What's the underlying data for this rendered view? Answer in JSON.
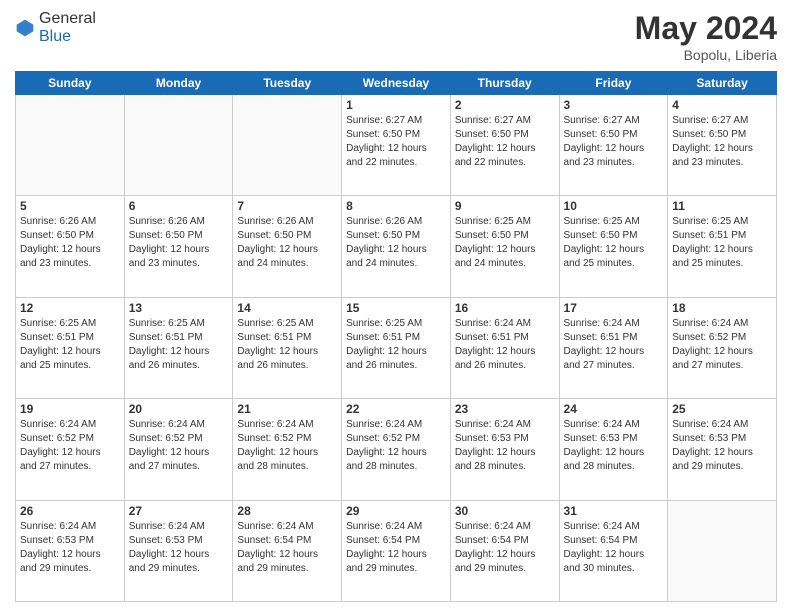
{
  "logo": {
    "general": "General",
    "blue": "Blue"
  },
  "header": {
    "month_year": "May 2024",
    "location": "Bopolu, Liberia"
  },
  "days_of_week": [
    "Sunday",
    "Monday",
    "Tuesday",
    "Wednesday",
    "Thursday",
    "Friday",
    "Saturday"
  ],
  "weeks": [
    [
      {
        "day": "",
        "info": ""
      },
      {
        "day": "",
        "info": ""
      },
      {
        "day": "",
        "info": ""
      },
      {
        "day": "1",
        "info": "Sunrise: 6:27 AM\nSunset: 6:50 PM\nDaylight: 12 hours and 22 minutes."
      },
      {
        "day": "2",
        "info": "Sunrise: 6:27 AM\nSunset: 6:50 PM\nDaylight: 12 hours and 22 minutes."
      },
      {
        "day": "3",
        "info": "Sunrise: 6:27 AM\nSunset: 6:50 PM\nDaylight: 12 hours and 23 minutes."
      },
      {
        "day": "4",
        "info": "Sunrise: 6:27 AM\nSunset: 6:50 PM\nDaylight: 12 hours and 23 minutes."
      }
    ],
    [
      {
        "day": "5",
        "info": "Sunrise: 6:26 AM\nSunset: 6:50 PM\nDaylight: 12 hours and 23 minutes."
      },
      {
        "day": "6",
        "info": "Sunrise: 6:26 AM\nSunset: 6:50 PM\nDaylight: 12 hours and 23 minutes."
      },
      {
        "day": "7",
        "info": "Sunrise: 6:26 AM\nSunset: 6:50 PM\nDaylight: 12 hours and 24 minutes."
      },
      {
        "day": "8",
        "info": "Sunrise: 6:26 AM\nSunset: 6:50 PM\nDaylight: 12 hours and 24 minutes."
      },
      {
        "day": "9",
        "info": "Sunrise: 6:25 AM\nSunset: 6:50 PM\nDaylight: 12 hours and 24 minutes."
      },
      {
        "day": "10",
        "info": "Sunrise: 6:25 AM\nSunset: 6:50 PM\nDaylight: 12 hours and 25 minutes."
      },
      {
        "day": "11",
        "info": "Sunrise: 6:25 AM\nSunset: 6:51 PM\nDaylight: 12 hours and 25 minutes."
      }
    ],
    [
      {
        "day": "12",
        "info": "Sunrise: 6:25 AM\nSunset: 6:51 PM\nDaylight: 12 hours and 25 minutes."
      },
      {
        "day": "13",
        "info": "Sunrise: 6:25 AM\nSunset: 6:51 PM\nDaylight: 12 hours and 26 minutes."
      },
      {
        "day": "14",
        "info": "Sunrise: 6:25 AM\nSunset: 6:51 PM\nDaylight: 12 hours and 26 minutes."
      },
      {
        "day": "15",
        "info": "Sunrise: 6:25 AM\nSunset: 6:51 PM\nDaylight: 12 hours and 26 minutes."
      },
      {
        "day": "16",
        "info": "Sunrise: 6:24 AM\nSunset: 6:51 PM\nDaylight: 12 hours and 26 minutes."
      },
      {
        "day": "17",
        "info": "Sunrise: 6:24 AM\nSunset: 6:51 PM\nDaylight: 12 hours and 27 minutes."
      },
      {
        "day": "18",
        "info": "Sunrise: 6:24 AM\nSunset: 6:52 PM\nDaylight: 12 hours and 27 minutes."
      }
    ],
    [
      {
        "day": "19",
        "info": "Sunrise: 6:24 AM\nSunset: 6:52 PM\nDaylight: 12 hours and 27 minutes."
      },
      {
        "day": "20",
        "info": "Sunrise: 6:24 AM\nSunset: 6:52 PM\nDaylight: 12 hours and 27 minutes."
      },
      {
        "day": "21",
        "info": "Sunrise: 6:24 AM\nSunset: 6:52 PM\nDaylight: 12 hours and 28 minutes."
      },
      {
        "day": "22",
        "info": "Sunrise: 6:24 AM\nSunset: 6:52 PM\nDaylight: 12 hours and 28 minutes."
      },
      {
        "day": "23",
        "info": "Sunrise: 6:24 AM\nSunset: 6:53 PM\nDaylight: 12 hours and 28 minutes."
      },
      {
        "day": "24",
        "info": "Sunrise: 6:24 AM\nSunset: 6:53 PM\nDaylight: 12 hours and 28 minutes."
      },
      {
        "day": "25",
        "info": "Sunrise: 6:24 AM\nSunset: 6:53 PM\nDaylight: 12 hours and 29 minutes."
      }
    ],
    [
      {
        "day": "26",
        "info": "Sunrise: 6:24 AM\nSunset: 6:53 PM\nDaylight: 12 hours and 29 minutes."
      },
      {
        "day": "27",
        "info": "Sunrise: 6:24 AM\nSunset: 6:53 PM\nDaylight: 12 hours and 29 minutes."
      },
      {
        "day": "28",
        "info": "Sunrise: 6:24 AM\nSunset: 6:54 PM\nDaylight: 12 hours and 29 minutes."
      },
      {
        "day": "29",
        "info": "Sunrise: 6:24 AM\nSunset: 6:54 PM\nDaylight: 12 hours and 29 minutes."
      },
      {
        "day": "30",
        "info": "Sunrise: 6:24 AM\nSunset: 6:54 PM\nDaylight: 12 hours and 29 minutes."
      },
      {
        "day": "31",
        "info": "Sunrise: 6:24 AM\nSunset: 6:54 PM\nDaylight: 12 hours and 30 minutes."
      },
      {
        "day": "",
        "info": ""
      }
    ]
  ]
}
